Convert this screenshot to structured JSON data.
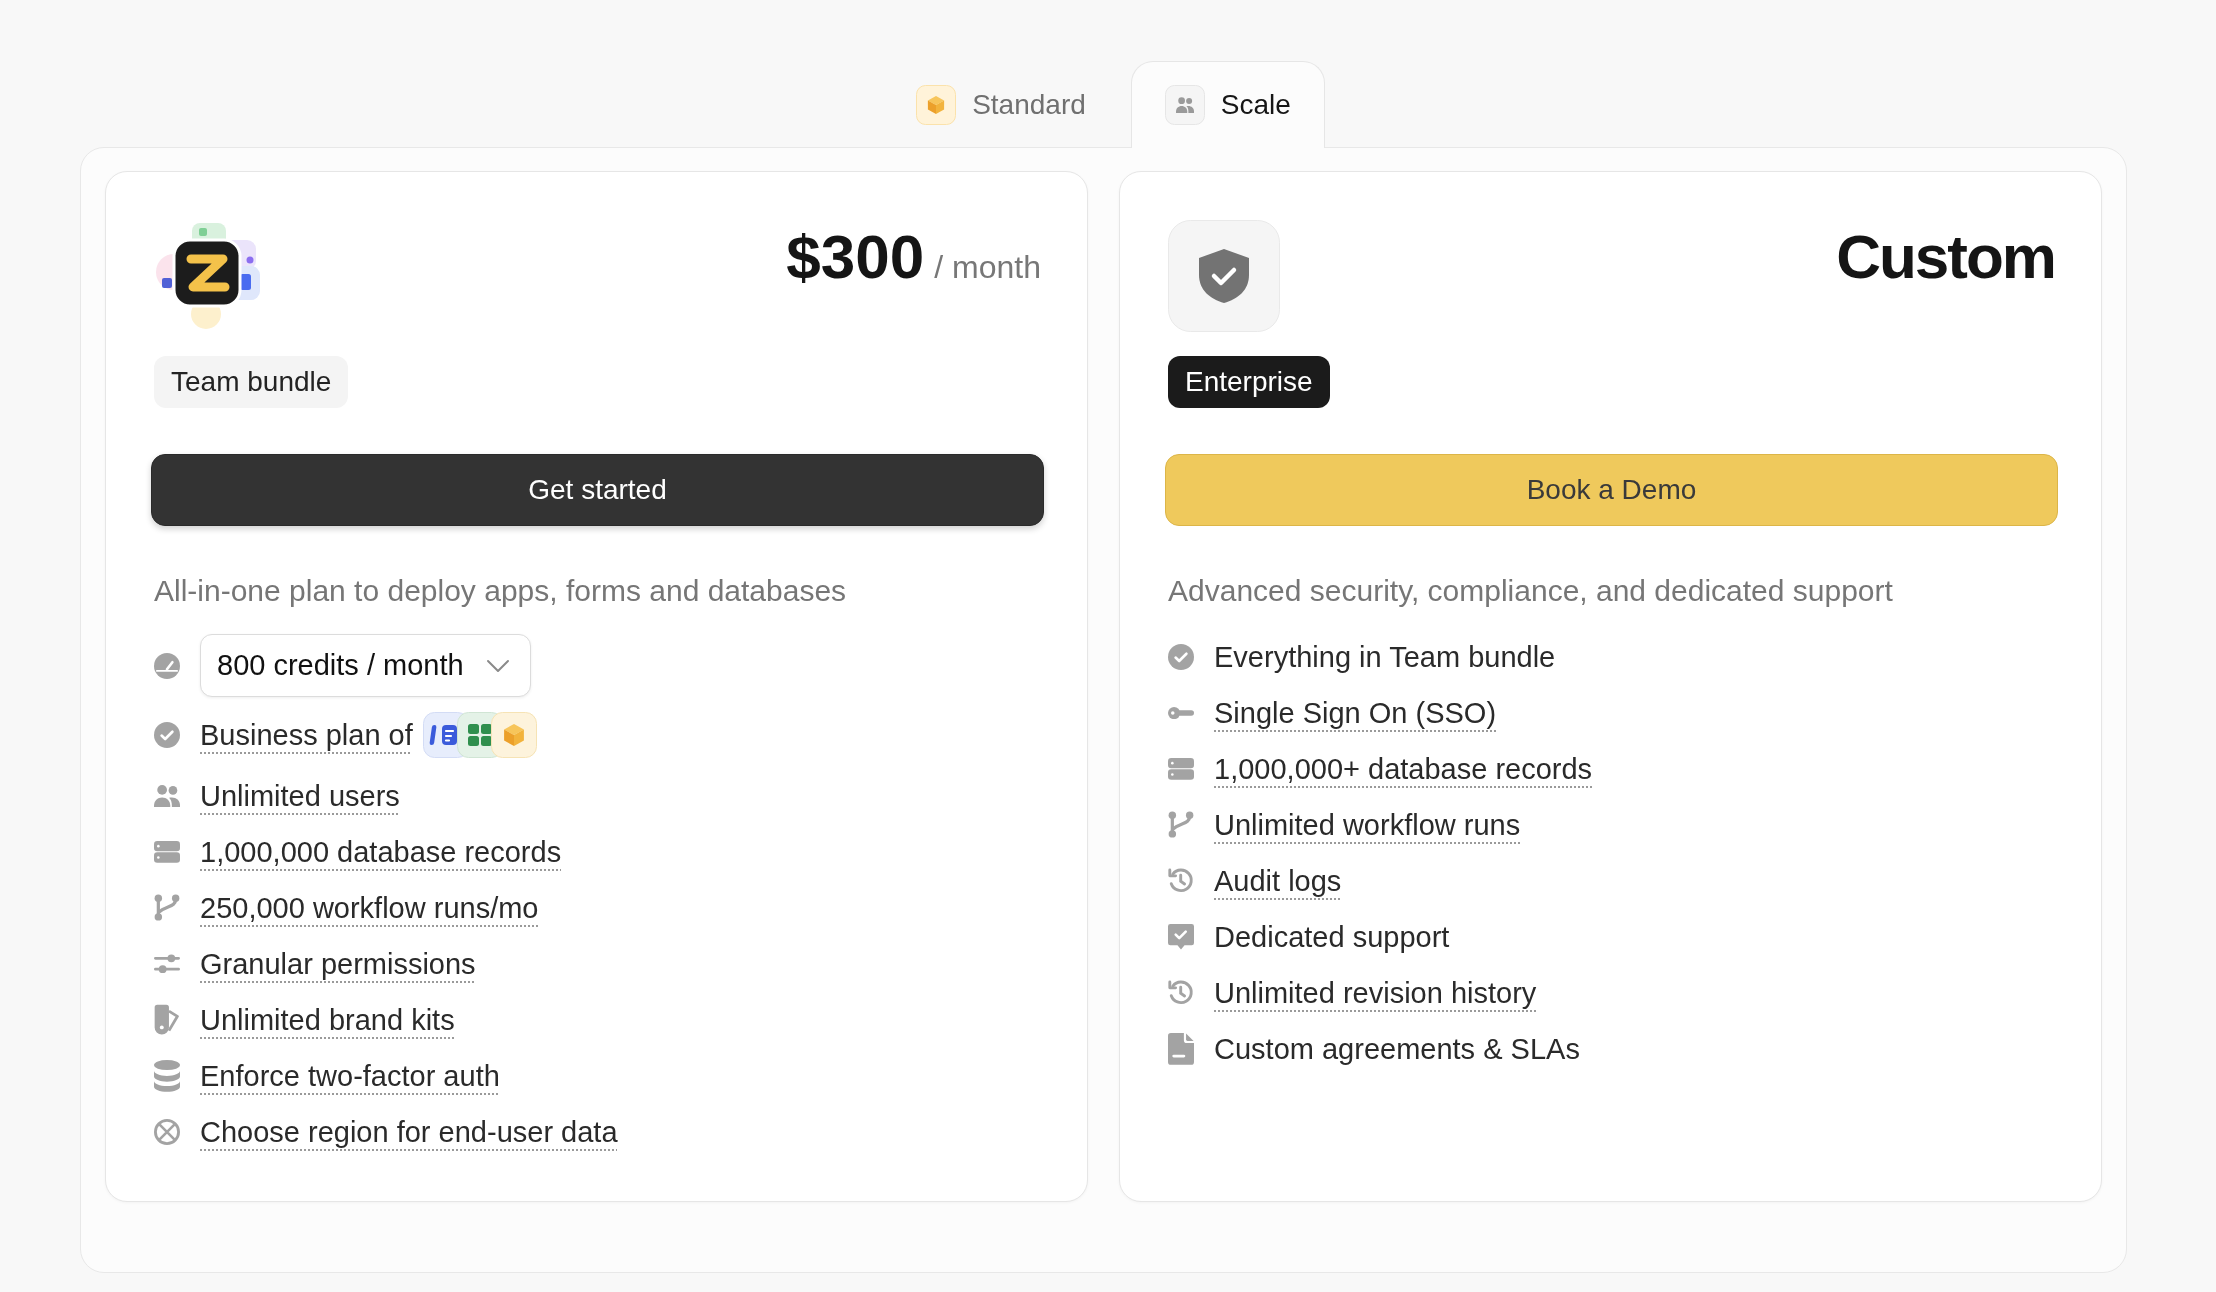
{
  "tabs": [
    {
      "label": "Standard",
      "selected": false
    },
    {
      "label": "Scale",
      "selected": true
    }
  ],
  "plans": [
    {
      "kind": "bundle",
      "price": "$300",
      "period": "/ month",
      "badge": "Team bundle",
      "button": "Get started",
      "description": "All-in-one plan to deploy apps, forms and databases",
      "features": [
        {
          "kind": "dropdown",
          "value": "800 credits / month"
        },
        {
          "kind": "apps",
          "label": "Business plan of",
          "underlined": true
        },
        {
          "kind": "text",
          "label": "Unlimited users",
          "underlined": true
        },
        {
          "kind": "text",
          "label": "1,000,000 database records",
          "underlined": true
        },
        {
          "kind": "text",
          "label": "250,000 workflow runs/mo",
          "underlined": true
        },
        {
          "kind": "text",
          "label": "Granular permissions",
          "underlined": true
        },
        {
          "kind": "text",
          "label": "Unlimited brand kits",
          "underlined": true
        },
        {
          "kind": "text",
          "label": "Enforce two-factor auth",
          "underlined": true
        },
        {
          "kind": "text",
          "label": "Choose region for end-user data",
          "underlined": true
        }
      ]
    },
    {
      "kind": "enterprise",
      "price": "Custom",
      "badge": "Enterprise",
      "button": "Book a Demo",
      "description": "Advanced security, compliance, and dedicated support",
      "features": [
        {
          "kind": "text",
          "label": "Everything in Team bundle",
          "underlined": false
        },
        {
          "kind": "text",
          "label": "Single Sign On (SSO)",
          "underlined": true
        },
        {
          "kind": "text",
          "label": "1,000,000+ database records",
          "underlined": true
        },
        {
          "kind": "text",
          "label": "Unlimited workflow runs",
          "underlined": true
        },
        {
          "kind": "text",
          "label": "Audit logs",
          "underlined": true
        },
        {
          "kind": "text",
          "label": "Dedicated support",
          "underlined": false
        },
        {
          "kind": "text",
          "label": "Unlimited revision history",
          "underlined": true
        },
        {
          "kind": "text",
          "label": "Custom agreements & SLAs",
          "underlined": false
        }
      ]
    }
  ]
}
